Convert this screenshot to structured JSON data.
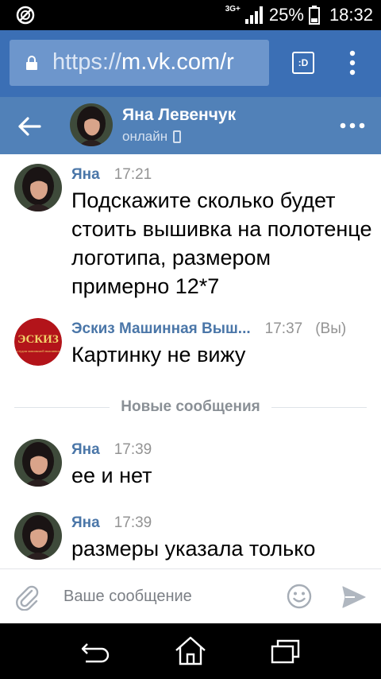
{
  "status_bar": {
    "network_type": "3G+",
    "battery_percent": "25%",
    "time": "18:32"
  },
  "browser": {
    "url_scheme": "https://",
    "url_host": "m.vk.com/r",
    "tab_label": ":D"
  },
  "header": {
    "contact_name": "Яна Левенчук",
    "status": "онлайн"
  },
  "messages": [
    {
      "author": "Яна",
      "time": "17:21",
      "text": "Подскажите сколько будет стоить вышивка на полотенце логотипа, размером примерно 12*7"
    },
    {
      "author": "Эскиз Машинная Выш...",
      "time": "17:37",
      "you_label": "(Вы)",
      "text": "Картинку не вижу",
      "avatar_text": "ЭСКИЗ",
      "avatar_subtext": "студия машинной вышивки"
    },
    {
      "author": "Яна",
      "time": "17:39",
      "text": "ее и нет"
    },
    {
      "author": "Яна",
      "time": "17:39",
      "text": "размеры указала только"
    }
  ],
  "divider": {
    "label": "Новые сообщения"
  },
  "composer": {
    "placeholder": "Ваше сообщение"
  },
  "colors": {
    "browser_bar": "#3b6fb5",
    "vk_header": "#5181b8",
    "author_blue": "#4a76a8",
    "logo_red": "#b3141a"
  }
}
